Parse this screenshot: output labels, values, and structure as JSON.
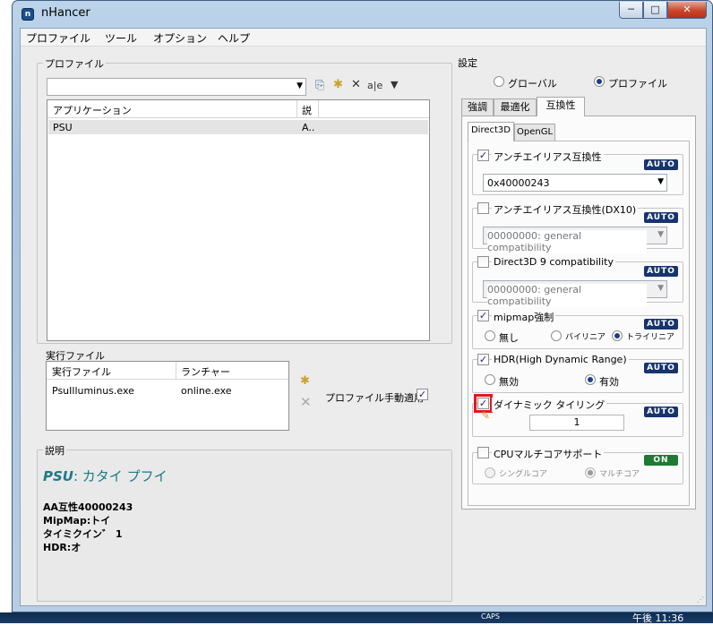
{
  "window": {
    "title": "nHancer",
    "minimize": "─",
    "maximize": "□",
    "close": "✕",
    "icon": "nh-app-icon"
  },
  "menu": [
    "プロファイル",
    "ツール",
    "オプション",
    "ヘルプ"
  ],
  "profiles": {
    "group_label": "プロファイル",
    "search_value": "",
    "toolbar_icons": [
      "copy-icon",
      "new-icon",
      "delete-icon",
      "rename-icon",
      "filter-icon"
    ],
    "toolbar_glyphs": [
      "⎘",
      "✱",
      "✕",
      "a|e",
      "▼"
    ],
    "columns": [
      "アプリケーション",
      "説"
    ],
    "rows": [
      {
        "app": "PSU",
        "desc": "A.."
      }
    ]
  },
  "executables": {
    "group_label": "実行ファイル",
    "columns": [
      "実行ファイル",
      "ランチャー"
    ],
    "rows": [
      {
        "exe": "PsuIlluminus.exe",
        "launcher": "online.exe"
      }
    ],
    "auto_apply_label": "プロファイル手動適用",
    "auto_apply_checked": true
  },
  "description": {
    "group_label": "説明",
    "title_app": "PSU",
    "title_rest": ": カタイ プフイ",
    "lines": [
      "AA互性40000243",
      "MipMap:トイ",
      "タイミクイン゛ 1",
      "HDR:オ"
    ]
  },
  "settings": {
    "group_label": "設定",
    "scope_options": [
      "グローバル",
      "プロファイル"
    ],
    "scope_selected": 1,
    "tabs": [
      "強調",
      "最適化",
      "互換性"
    ],
    "active_tab": 2,
    "api_tabs": [
      "Direct3D",
      "OpenGL"
    ],
    "active_api_tab": 0,
    "sections": {
      "aa_compat": {
        "label": "アンチエイリアス互換性",
        "checked": true,
        "badge": "AUTO",
        "value": "0x40000243"
      },
      "aa_compat_dx10": {
        "label": "アンチエイリアス互換性(DX10)",
        "checked": false,
        "badge": "AUTO",
        "value": "00000000: general compatibility"
      },
      "d3d9_compat": {
        "label": "Direct3D 9 compatibility",
        "checked": false,
        "badge": "AUTO",
        "value": "00000000: general compatibility"
      },
      "mipmap": {
        "label": "mipmap強制",
        "checked": true,
        "badge": "AUTO",
        "options": [
          "無し",
          "バイリニア",
          "トライリニア"
        ],
        "selected": 2
      },
      "hdr": {
        "label": "HDR(High Dynamic Range)",
        "checked": true,
        "badge": "AUTO",
        "options": [
          "無効",
          "有効"
        ],
        "selected": 1
      },
      "tiling": {
        "label": "ダイナミック タイリング",
        "checked": true,
        "badge": "AUTO",
        "value": "1"
      },
      "multicore": {
        "label": "CPUマルチコアサポート",
        "checked": false,
        "badge": "ON",
        "options": [
          "シングルコア",
          "マルチコア"
        ],
        "selected": 1
      }
    }
  },
  "taskbar": {
    "clock": "午後 11:36",
    "caps": "CAPS"
  }
}
